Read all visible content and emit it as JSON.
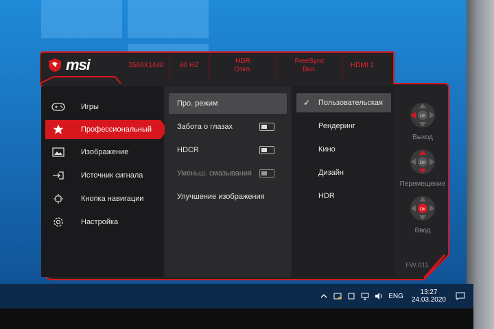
{
  "brand": {
    "name": "msi",
    "accent": "#d8161d"
  },
  "status_bar": [
    {
      "line1": "2560X1440",
      "line2": ""
    },
    {
      "line1": "60 HZ",
      "line2": ""
    },
    {
      "line1": "HDR",
      "line2": "Откл."
    },
    {
      "line1": "FreeSync",
      "line2": "Вкл."
    },
    {
      "line1": "HDMI 1",
      "line2": ""
    }
  ],
  "main_menu": [
    {
      "label": "Игры",
      "icon": "gamepad-icon",
      "active": false
    },
    {
      "label": "Профессиональный",
      "icon": "star-icon",
      "active": true
    },
    {
      "label": "Изображение",
      "icon": "image-icon",
      "active": false
    },
    {
      "label": "Источник сигнала",
      "icon": "input-source-icon",
      "active": false
    },
    {
      "label": "Кнопка навигации",
      "icon": "navigation-key-icon",
      "active": false
    },
    {
      "label": "Настройка",
      "icon": "gear-icon",
      "active": false
    }
  ],
  "sub_menu": [
    {
      "label": "Про. режим",
      "toggle": false,
      "selected": true,
      "disabled": false
    },
    {
      "label": "Забота о глазах",
      "toggle": true,
      "selected": false,
      "disabled": false
    },
    {
      "label": "HDCR",
      "toggle": true,
      "selected": false,
      "disabled": false
    },
    {
      "label": "Уменьш. смазывания",
      "toggle": true,
      "selected": false,
      "disabled": true
    },
    {
      "label": "Улучшение изображения",
      "toggle": false,
      "selected": false,
      "disabled": false
    }
  ],
  "options": [
    {
      "label": "Пользовательская",
      "checked": true
    },
    {
      "label": "Рендеринг",
      "checked": false
    },
    {
      "label": "Кино",
      "checked": false
    },
    {
      "label": "Дизайн",
      "checked": false
    },
    {
      "label": "HDR",
      "checked": false
    }
  ],
  "nav_hints": [
    {
      "label": "Выход",
      "center": "OK",
      "highlight": "left"
    },
    {
      "label": "Перемещение",
      "center": "OK",
      "highlight": "updown"
    },
    {
      "label": "Ввод",
      "center": "OK",
      "highlight": "center"
    }
  ],
  "firmware": "FW.011",
  "taskbar": {
    "language": "ENG",
    "time": "13:27",
    "date": "24.03.2020"
  }
}
